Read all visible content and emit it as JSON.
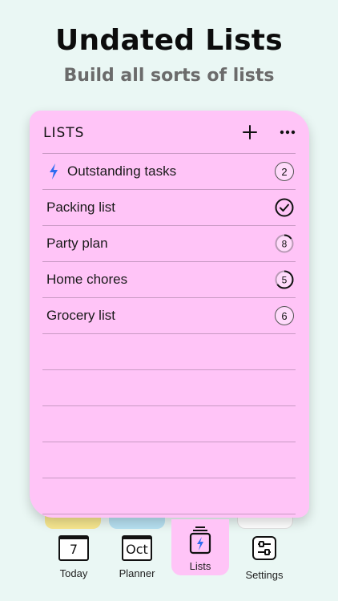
{
  "headline": "Undated Lists",
  "subheadline": "Build all sorts of lists",
  "panel": {
    "title": "LISTS",
    "accent_color": "#2f6cf0",
    "background_color": "#ffc4f7",
    "add_icon": "plus-icon",
    "more_icon": "more-horizontal-icon"
  },
  "lists": [
    {
      "label": "Outstanding tasks",
      "icon": "bolt-icon",
      "badge": "2",
      "badge_type": "count"
    },
    {
      "label": "Packing list",
      "badge": "",
      "badge_type": "complete",
      "progress": 1.0
    },
    {
      "label": "Party plan",
      "badge": "8",
      "badge_type": "progress",
      "progress": 0.15
    },
    {
      "label": "Home chores",
      "badge": "5",
      "badge_type": "progress",
      "progress": 0.65
    },
    {
      "label": "Grocery list",
      "badge": "6",
      "badge_type": "count"
    }
  ],
  "tabbar": {
    "today": {
      "label": "Today",
      "icon_text": "7",
      "icon": "calendar-day-icon"
    },
    "planner": {
      "label": "Planner",
      "icon_text": "Oct",
      "icon": "calendar-month-icon"
    },
    "lists": {
      "label": "Lists",
      "icon": "lists-stack-icon",
      "active": true
    },
    "settings": {
      "label": "Settings",
      "icon": "sliders-icon"
    }
  }
}
